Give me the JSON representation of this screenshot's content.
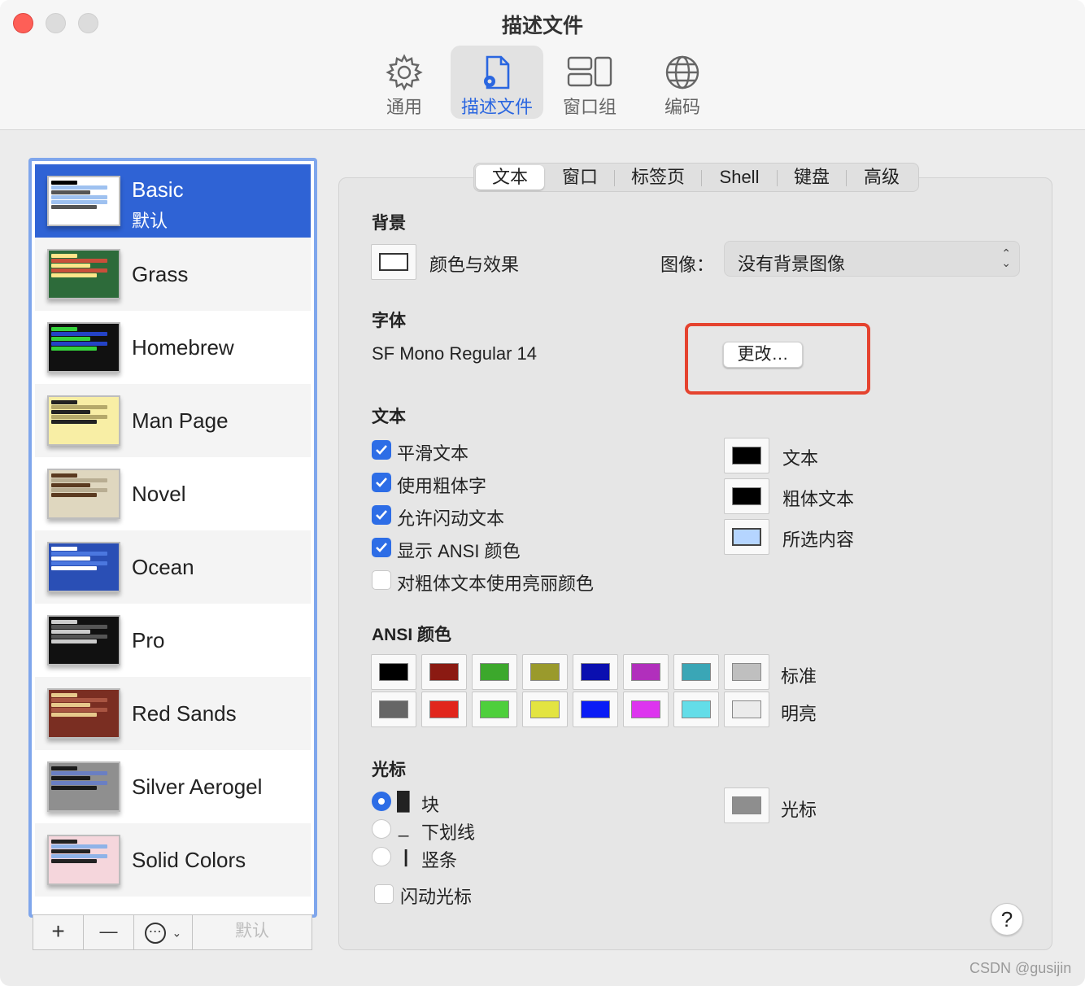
{
  "window": {
    "title": "描述文件"
  },
  "toolbar": [
    {
      "label": "通用",
      "icon": "gear-icon"
    },
    {
      "label": "描述文件",
      "icon": "profile-document-icon"
    },
    {
      "label": "窗口组",
      "icon": "window-group-icon"
    },
    {
      "label": "编码",
      "icon": "globe-icon"
    }
  ],
  "sidebar": {
    "profiles": [
      {
        "name": "Basic",
        "sub": "默认",
        "bg": "#ffffff",
        "fg": "#000000",
        "accent": "#9ec1f0"
      },
      {
        "name": "Grass",
        "bg": "#2d6b3a",
        "fg": "#ffe58a",
        "accent": "#c94f3a"
      },
      {
        "name": "Homebrew",
        "bg": "#111111",
        "fg": "#35d13b",
        "accent": "#2443c6"
      },
      {
        "name": "Man Page",
        "bg": "#f8eea5",
        "fg": "#222222",
        "accent": "#b5a96a"
      },
      {
        "name": "Novel",
        "bg": "#dfd7bf",
        "fg": "#5a3a20",
        "accent": "#b8ad92"
      },
      {
        "name": "Ocean",
        "bg": "#2a4fb5",
        "fg": "#ffffff",
        "accent": "#4b77df"
      },
      {
        "name": "Pro",
        "bg": "#111111",
        "fg": "#cccccc",
        "accent": "#555555"
      },
      {
        "name": "Red Sands",
        "bg": "#7a2e22",
        "fg": "#e7c98c",
        "accent": "#a95542"
      },
      {
        "name": "Silver Aerogel",
        "bg": "#8f8f8f",
        "fg": "#1a1a1a",
        "accent": "#6a7fc3"
      },
      {
        "name": "Solid Colors",
        "bg": "#f5d6dc",
        "fg": "#222222",
        "accent": "#8fb3e8"
      }
    ],
    "controls": {
      "add": "+",
      "remove": "—",
      "more": "⋯",
      "default": "默认"
    }
  },
  "tabs": [
    {
      "label": "文本",
      "active": true
    },
    {
      "label": "窗口"
    },
    {
      "label": "标签页"
    },
    {
      "label": "Shell"
    },
    {
      "label": "键盘"
    },
    {
      "label": "高级"
    }
  ],
  "background": {
    "section": "背景",
    "color_effects": "颜色与效果",
    "image_label": "图像：",
    "image_value": "没有背景图像"
  },
  "font": {
    "section": "字体",
    "value": "SF Mono Regular 14",
    "change": "更改…"
  },
  "text": {
    "section": "文本",
    "options": [
      {
        "label": "平滑文本",
        "checked": true
      },
      {
        "label": "使用粗体字",
        "checked": true
      },
      {
        "label": "允许闪动文本",
        "checked": true
      },
      {
        "label": "显示 ANSI 颜色",
        "checked": true
      },
      {
        "label": "对粗体文本使用亮丽颜色",
        "checked": false
      }
    ],
    "colors": [
      {
        "label": "文本",
        "color": "#000000"
      },
      {
        "label": "粗体文本",
        "color": "#000000"
      },
      {
        "label": "所选内容",
        "color": "#b5d5ff"
      }
    ]
  },
  "ansi": {
    "section": "ANSI 颜色",
    "normal_label": "标准",
    "bright_label": "明亮",
    "normal": [
      "#000000",
      "#8b1a12",
      "#3ca82c",
      "#9a9a2c",
      "#0a0fb0",
      "#b12fbc",
      "#3aa6b6",
      "#bfbfbf"
    ],
    "bright": [
      "#666666",
      "#e1261c",
      "#4ecf3c",
      "#e3e441",
      "#0a1cf5",
      "#dd35ef",
      "#63dde8",
      "#ebebeb"
    ]
  },
  "cursor": {
    "section": "光标",
    "styles": [
      {
        "glyph": "█",
        "label": "块",
        "selected": true
      },
      {
        "glyph": "_",
        "label": "下划线",
        "selected": false
      },
      {
        "glyph": "|",
        "label": "竖条",
        "selected": false
      }
    ],
    "blink": "闪动光标",
    "color_label": "光标",
    "color": "#8e8e8e"
  },
  "help": "?",
  "watermark": "CSDN @gusijin"
}
